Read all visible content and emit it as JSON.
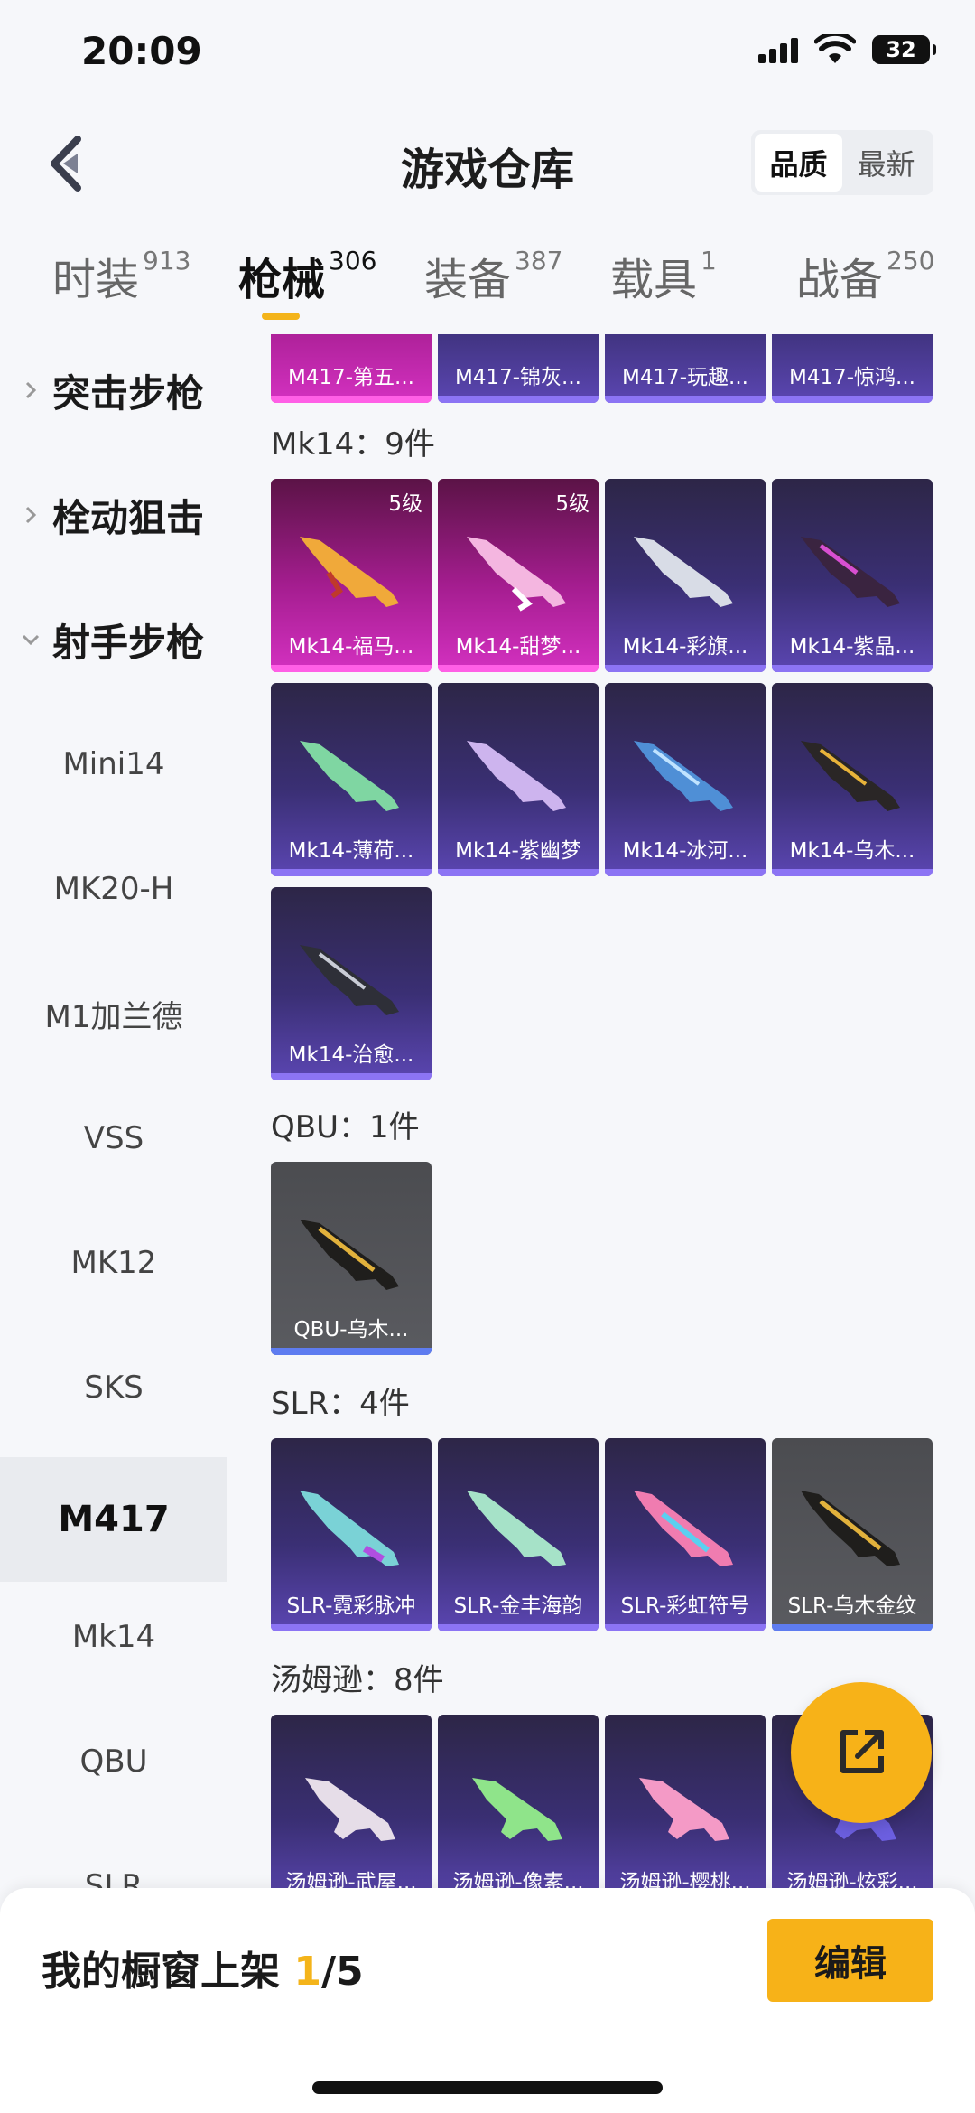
{
  "status": {
    "time": "20:09",
    "battery": "32"
  },
  "header": {
    "title": "游戏仓库",
    "sort_quality": "品质",
    "sort_latest": "最新"
  },
  "tabs": [
    {
      "label": "时装",
      "count": "913"
    },
    {
      "label": "枪械",
      "count": "306"
    },
    {
      "label": "装备",
      "count": "387"
    },
    {
      "label": "载具",
      "count": "1"
    },
    {
      "label": "战备",
      "count": "250"
    }
  ],
  "sidebar": {
    "categories": [
      "突击步枪",
      "栓动狙击",
      "射手步枪"
    ],
    "items": [
      "Mini14",
      "MK20-H",
      "M1加兰德",
      "VSS",
      "MK12",
      "SKS",
      "M417",
      "Mk14",
      "QBU",
      "SLR"
    ],
    "selected": "M417"
  },
  "sections": {
    "m417": {
      "items": [
        "M417-第五...",
        "M417-锦灰...",
        "M417-玩趣...",
        "M417-惊鸿..."
      ]
    },
    "mk14": {
      "title": "Mk14：9件",
      "items": [
        {
          "name": "Mk14-福马...",
          "level": "5级"
        },
        {
          "name": "Mk14-甜梦...",
          "level": "5级"
        },
        {
          "name": "Mk14-彩旗..."
        },
        {
          "name": "Mk14-紫晶..."
        },
        {
          "name": "Mk14-薄荷..."
        },
        {
          "name": "Mk14-紫幽梦"
        },
        {
          "name": "Mk14-冰河..."
        },
        {
          "name": "Mk14-乌木..."
        },
        {
          "name": "Mk14-治愈..."
        }
      ]
    },
    "qbu": {
      "title": "QBU：1件",
      "items": [
        {
          "name": "QBU-乌木..."
        }
      ]
    },
    "slr": {
      "title": "SLR：4件",
      "items": [
        {
          "name": "SLR-霓彩脉冲"
        },
        {
          "name": "SLR-金丰海韵"
        },
        {
          "name": "SLR-彩虹符号"
        },
        {
          "name": "SLR-乌木金纹"
        }
      ]
    },
    "thompson": {
      "title": "汤姆逊：8件",
      "items": [
        {
          "name": "汤姆逊-武屋..."
        },
        {
          "name": "汤姆逊-像素..."
        },
        {
          "name": "汤姆逊-樱桃..."
        },
        {
          "name": "汤姆逊-炫彩..."
        }
      ]
    }
  },
  "bottom": {
    "label": "我的橱窗上架 ",
    "count": "1",
    "total": "/5",
    "edit": "编辑"
  },
  "colors": {
    "accent": "#f7b218",
    "purple_card": "#3a2f74",
    "pink_card": "#a41d8f",
    "gray_card": "#5a5b60"
  }
}
